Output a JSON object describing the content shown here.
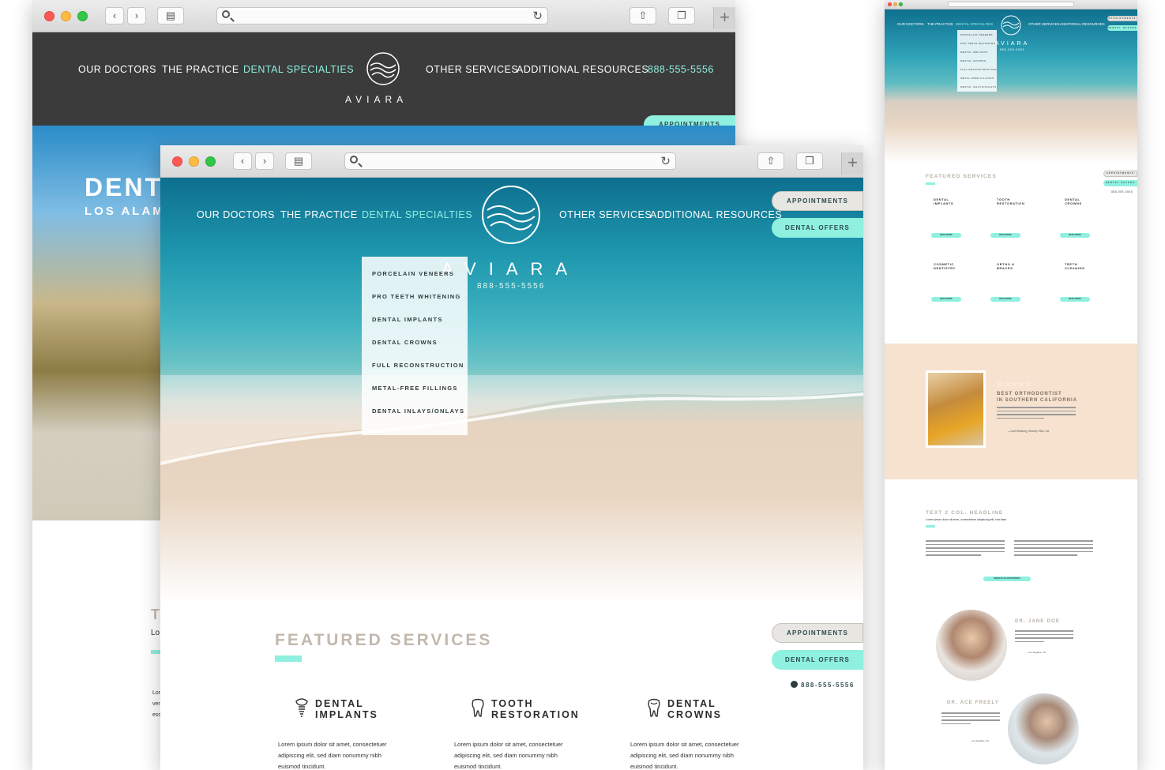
{
  "back_window": {
    "nav": [
      "OUR DOCTORS",
      "THE PRACTICE",
      "DENTAL SPECIALTIES",
      "OTHER SERVICES",
      "ADDITIONAL RESOURCES"
    ],
    "phone": "888-555-5556",
    "logo_text": "AVIARA",
    "appointments": "APPOINTMENTS",
    "hero_title": "DENT",
    "hero_subtitle": "LOS ALAM",
    "peek_title": "T",
    "peek_line": "Lo",
    "peek_text": [
      "Lor",
      "ver",
      "ess"
    ]
  },
  "front_window": {
    "nav": [
      "OUR DOCTORS",
      "THE PRACTICE",
      "DENTAL SPECIALTIES",
      "OTHER SERVICES",
      "ADDITIONAL RESOURCES"
    ],
    "logo_text": "AVIARA",
    "phone": "888-555-5556",
    "buttons": {
      "appointments": "APPOINTMENTS",
      "offers": "DENTAL OFFERS"
    },
    "dropdown": [
      "PORCELAIN VENEERS",
      "PRO TEETH WHITENING",
      "DENTAL IMPLANTS",
      "DENTAL CROWNS",
      "FULL RECONSTRUCTION",
      "METAL-FREE FILLINGS",
      "DENTAL INLAYS/ONLAYS"
    ],
    "section_title": "FEATURED SERVICES",
    "services": [
      {
        "name": "DENTAL\nIMPLANTS",
        "icon": "implant-icon",
        "desc": "Lorem ipsum dolor sit amet, consectetuer adipiscing elit, sed diam nonummy nibh euismod tincidunt."
      },
      {
        "name": "TOOTH\nRESTORATION",
        "icon": "tooth-icon",
        "desc": "Lorem ipsum dolor sit amet, consectetuer adipiscing elit, sed diam nonummy nibh euismod tincidunt."
      },
      {
        "name": "DENTAL\nCROWNS",
        "icon": "crown-icon",
        "desc": "Lorem ipsum dolor sit amet, consectetuer adipiscing elit, sed diam nonummy nibh euismod tincidunt."
      }
    ]
  },
  "right_window": {
    "nav": [
      "OUR DOCTORS",
      "THE PRACTICE",
      "DENTAL SPECIALTIES",
      "OTHER SERVICES",
      "ADDITIONAL RESOURCES"
    ],
    "logo_text": "AVIARA",
    "phone": "888-555-5556",
    "dropdown": [
      "PORCELAIN VENEERS",
      "PRO TEETH WHITENING",
      "DENTAL IMPLANTS",
      "DENTAL CROWNS",
      "FULL RECONSTRUCTION",
      "METAL-FREE FILLINGS",
      "DENTAL INLAYS/ONLAYS"
    ],
    "buttons": {
      "appointments": "APPOINTMENTS",
      "offers": "DENTAL OFFERS"
    },
    "section_title": "FEATURED SERVICES",
    "services": [
      "DENTAL\nIMPLANTS",
      "TOOTH\nRESTORATION",
      "DENTAL\nCROWNS",
      "COSMETIC\nDENTISTRY",
      "ORTHO &\nBRACES",
      "TEETH\nCLEANING"
    ],
    "read_more": "READ MORE",
    "stars": "☆☆☆☆☆",
    "testimonial_title": "BEST ORTHODONTIST\nIN SOUTHERN CALIFORNIA",
    "testimonial_author": "—Carl Redburg, Beverly Hills, CA",
    "two_col_title": "TEXT 2 COL. HEADLINE",
    "two_col_sub": "Lorem ipsum dolor sit amet, consectetuer adipiscing elit, sed diam",
    "request_btn": "REQUEST AN APPOINTMENT",
    "doctor1": "DR. JANE DOE",
    "doctor1_city": "Los Angeles, CA",
    "doctor2": "DR. ACE FREELY",
    "doctor2_city": "Los Angeles, CA"
  }
}
